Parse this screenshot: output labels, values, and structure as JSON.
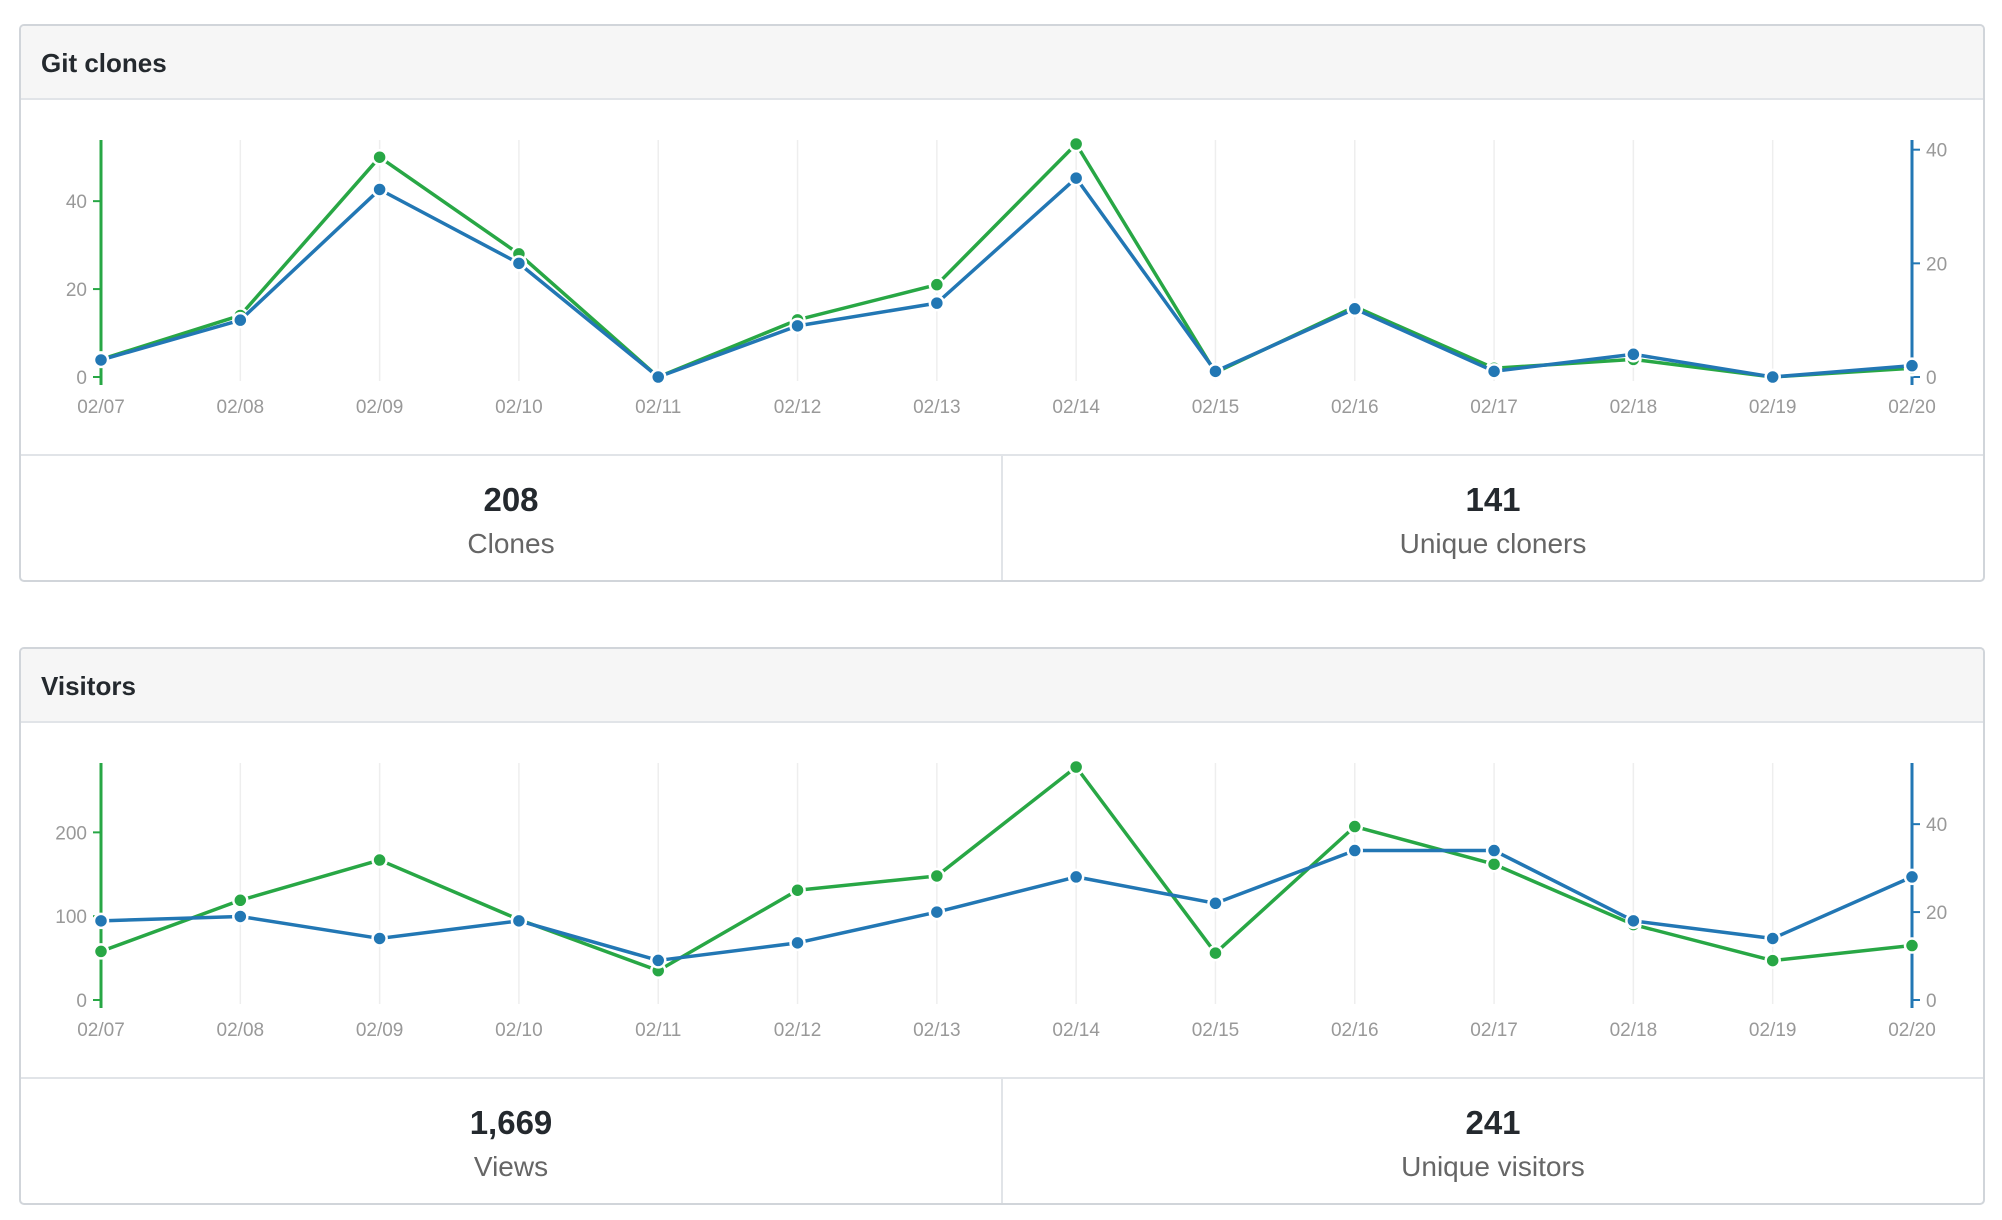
{
  "colors": {
    "clones_green": "#28a745",
    "unique_blue": "#2277b4",
    "grid": "#eeeeee",
    "tick_text": "#999999"
  },
  "clones_panel": {
    "title": "Git clones",
    "stats": [
      {
        "value": "208",
        "label": "Clones"
      },
      {
        "value": "141",
        "label": "Unique cloners"
      }
    ]
  },
  "visitors_panel": {
    "title": "Visitors",
    "stats": [
      {
        "value": "1,669",
        "label": "Views"
      },
      {
        "value": "241",
        "label": "Unique visitors"
      }
    ]
  },
  "chart_data": [
    {
      "type": "line",
      "title": "Git clones",
      "categories": [
        "02/07",
        "02/08",
        "02/09",
        "02/10",
        "02/11",
        "02/12",
        "02/13",
        "02/14",
        "02/15",
        "02/16",
        "02/17",
        "02/18",
        "02/19",
        "02/20"
      ],
      "left_axis": {
        "ticks": [
          0,
          20,
          40
        ],
        "ylim": [
          0,
          53
        ]
      },
      "right_axis": {
        "ticks": [
          0,
          20,
          40
        ],
        "ylim": [
          0,
          41
        ]
      },
      "grid": true,
      "series": [
        {
          "axis": "left",
          "color": "#28a745",
          "values": [
            4,
            14,
            50,
            28,
            0,
            13,
            21,
            53,
            1,
            16,
            2,
            4,
            0,
            2
          ]
        },
        {
          "axis": "right",
          "color": "#2277b4",
          "values": [
            3,
            10,
            33,
            20,
            0,
            9,
            13,
            35,
            1,
            12,
            1,
            4,
            0,
            2
          ]
        }
      ]
    },
    {
      "type": "line",
      "title": "Visitors",
      "categories": [
        "02/07",
        "02/08",
        "02/09",
        "02/10",
        "02/11",
        "02/12",
        "02/13",
        "02/14",
        "02/15",
        "02/16",
        "02/17",
        "02/18",
        "02/19",
        "02/20"
      ],
      "left_axis": {
        "ticks": [
          0,
          100,
          200
        ],
        "ylim": [
          0,
          278
        ]
      },
      "right_axis": {
        "ticks": [
          0,
          20,
          40
        ],
        "ylim": [
          0,
          53
        ]
      },
      "grid": true,
      "series": [
        {
          "axis": "left",
          "color": "#28a745",
          "values": [
            58,
            119,
            167,
            96,
            35,
            131,
            148,
            278,
            56,
            207,
            162,
            90,
            47,
            65
          ]
        },
        {
          "axis": "right",
          "color": "#2277b4",
          "values": [
            18,
            19,
            14,
            18,
            9,
            13,
            20,
            28,
            22,
            34,
            34,
            18,
            14,
            28
          ]
        }
      ]
    }
  ]
}
